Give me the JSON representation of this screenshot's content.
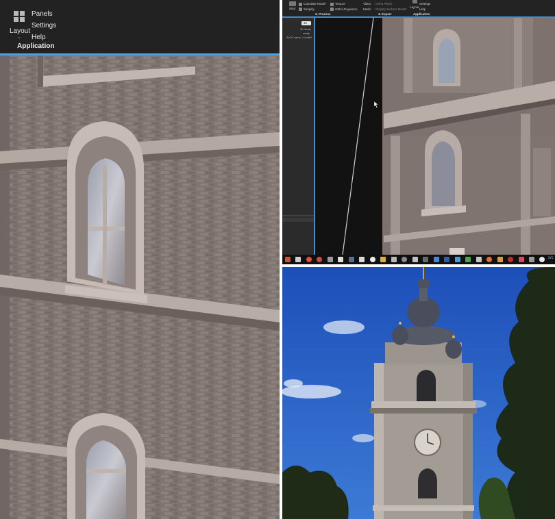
{
  "left_app": {
    "ribbon": {
      "layout_label": "Layout",
      "menu": [
        "Panels",
        "Settings",
        "Help"
      ],
      "group_label": "Application"
    }
  },
  "right_app": {
    "ribbon": {
      "start": "Start",
      "calculate_model": "Calculate Model",
      "simplify": "Simplify",
      "texture": "Texture",
      "ortho_projection": "Ortho Projection",
      "video": "Video",
      "mesh": "Mesh",
      "ortho_photo": "Ortho Photo",
      "display_surface_model": "Display Surface Model",
      "layout": "Layout",
      "settings": "Settings",
      "help": "Help",
      "group_process": "2. Process",
      "group_export": "3. Export",
      "group_application": "Application"
    },
    "sidebar": {
      "badge": "3D",
      "line1": "3D study",
      "line2": "ready",
      "line3": "24/24 cams, 1 model"
    },
    "taskbar_text": "x/c"
  },
  "colors": {
    "accent_blue": "#4aa3e8",
    "ribbon_bg": "#222222",
    "model_gray": "#817570",
    "sky_blue": "#2f64c6"
  }
}
